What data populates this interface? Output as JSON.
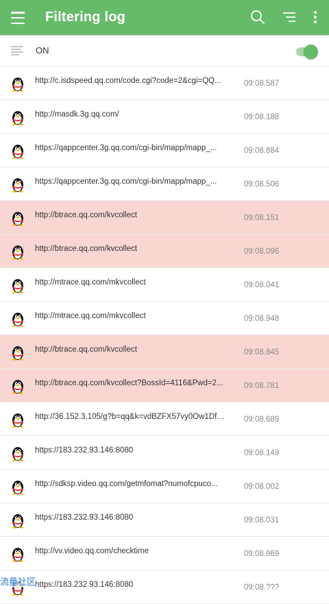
{
  "appbar": {
    "title": "Filtering log",
    "bg_color": "#66bb6a",
    "icons": [
      "menu-icon",
      "search-icon",
      "filter-icon",
      "more-vert-icon"
    ]
  },
  "filter_switch": {
    "state_label": "ON",
    "enabled": true
  },
  "log": {
    "highlight_color": "#f8d7d3",
    "entries": [
      {
        "url": "http://c.isdspeed.qq.com/code.cgi?code=2&cgi=QQ...",
        "time": "09:08.587",
        "highlighted": false
      },
      {
        "url": "http://masdk.3g.qq.com/",
        "time": "09:08.188",
        "highlighted": false
      },
      {
        "url": "https://qappcenter.3g.qq.com/cgi-bin/mapp/mapp_...",
        "time": "09:08.884",
        "highlighted": false
      },
      {
        "url": "https://qappcenter.3g.qq.com/cgi-bin/mapp/mapp_...",
        "time": "09:08.506",
        "highlighted": false
      },
      {
        "url": "http://btrace.qq.com/kvcollect",
        "time": "09:08.151",
        "highlighted": true
      },
      {
        "url": "http://btrace.qq.com/kvcollect",
        "time": "09:08.096",
        "highlighted": true
      },
      {
        "url": "http://mtrace.qq.com/mkvcollect",
        "time": "09:08.041",
        "highlighted": false
      },
      {
        "url": "http://mtrace.qq.com/mkvcollect",
        "time": "09:08.948",
        "highlighted": false
      },
      {
        "url": "http://btrace.qq.com/kvcollect",
        "time": "09:08.845",
        "highlighted": true
      },
      {
        "url": "http://btrace.qq.com/kvcollect?BossId=4116&Pwd=2...",
        "time": "09:08.781",
        "highlighted": true
      },
      {
        "url": "http://36.152.3.105/g?b=qq&k=vdBZFX57vy0Ow1DfS...",
        "time": "09:08.689",
        "highlighted": false
      },
      {
        "url": "https://183.232.93.146:8080",
        "time": "09:08.149",
        "highlighted": false
      },
      {
        "url": "http://sdksp.video.qq.com/getmfomat?numofcpuco...",
        "time": "09:08.002",
        "highlighted": false
      },
      {
        "url": "https://183.232.93.146:8080",
        "time": "09:08.031",
        "highlighted": false
      },
      {
        "url": "http://vv.video.qq.com/checktime",
        "time": "09:08.969",
        "highlighted": false
      },
      {
        "url": "https://183.232.93.146:8080",
        "time": "09:08.???",
        "highlighted": false
      }
    ]
  },
  "watermark": "流量社区"
}
